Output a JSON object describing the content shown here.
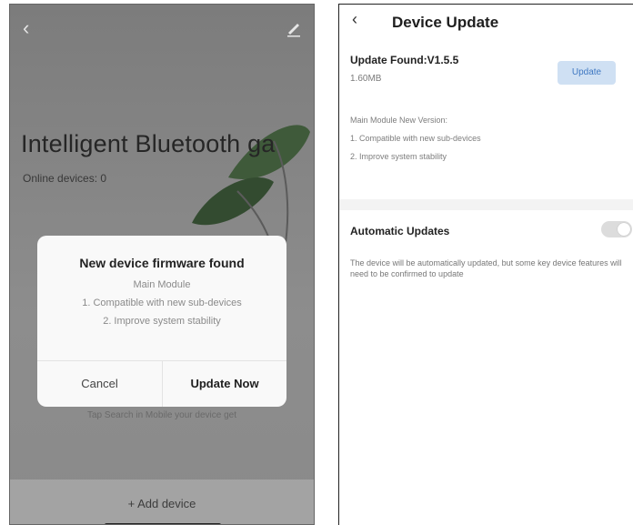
{
  "left_screen": {
    "back_icon": "chevron-left-icon",
    "edit_icon": "pencil-icon",
    "title": "Intelligent Bluetooth ga",
    "online_devices": "Online devices: 0",
    "hint": "Tap Search in Mobile your device get",
    "add_device": "+ Add device",
    "dialog": {
      "title": "New device firmware found",
      "lines": [
        "Main Module",
        "1. Compatible with new sub-devices",
        "2. Improve system stability"
      ],
      "cancel_label": "Cancel",
      "update_now_label": "Update Now"
    }
  },
  "right_screen": {
    "back_icon": "chevron-left-icon",
    "title": "Device Update",
    "update_found": "Update Found:V1.5.5",
    "size": "1.60MB",
    "update_button": "Update",
    "notes": [
      "Main Module New Version:",
      "1. Compatible with new sub-devices",
      "2. Improve system stability"
    ],
    "auto_updates_label": "Automatic Updates",
    "auto_updates_enabled": false,
    "auto_updates_desc": "The device will be automatically updated, but some key device features will need to be confirmed to update"
  },
  "colors": {
    "accent": "#3f78c2",
    "update_button_bg": "#cfe0f3"
  }
}
